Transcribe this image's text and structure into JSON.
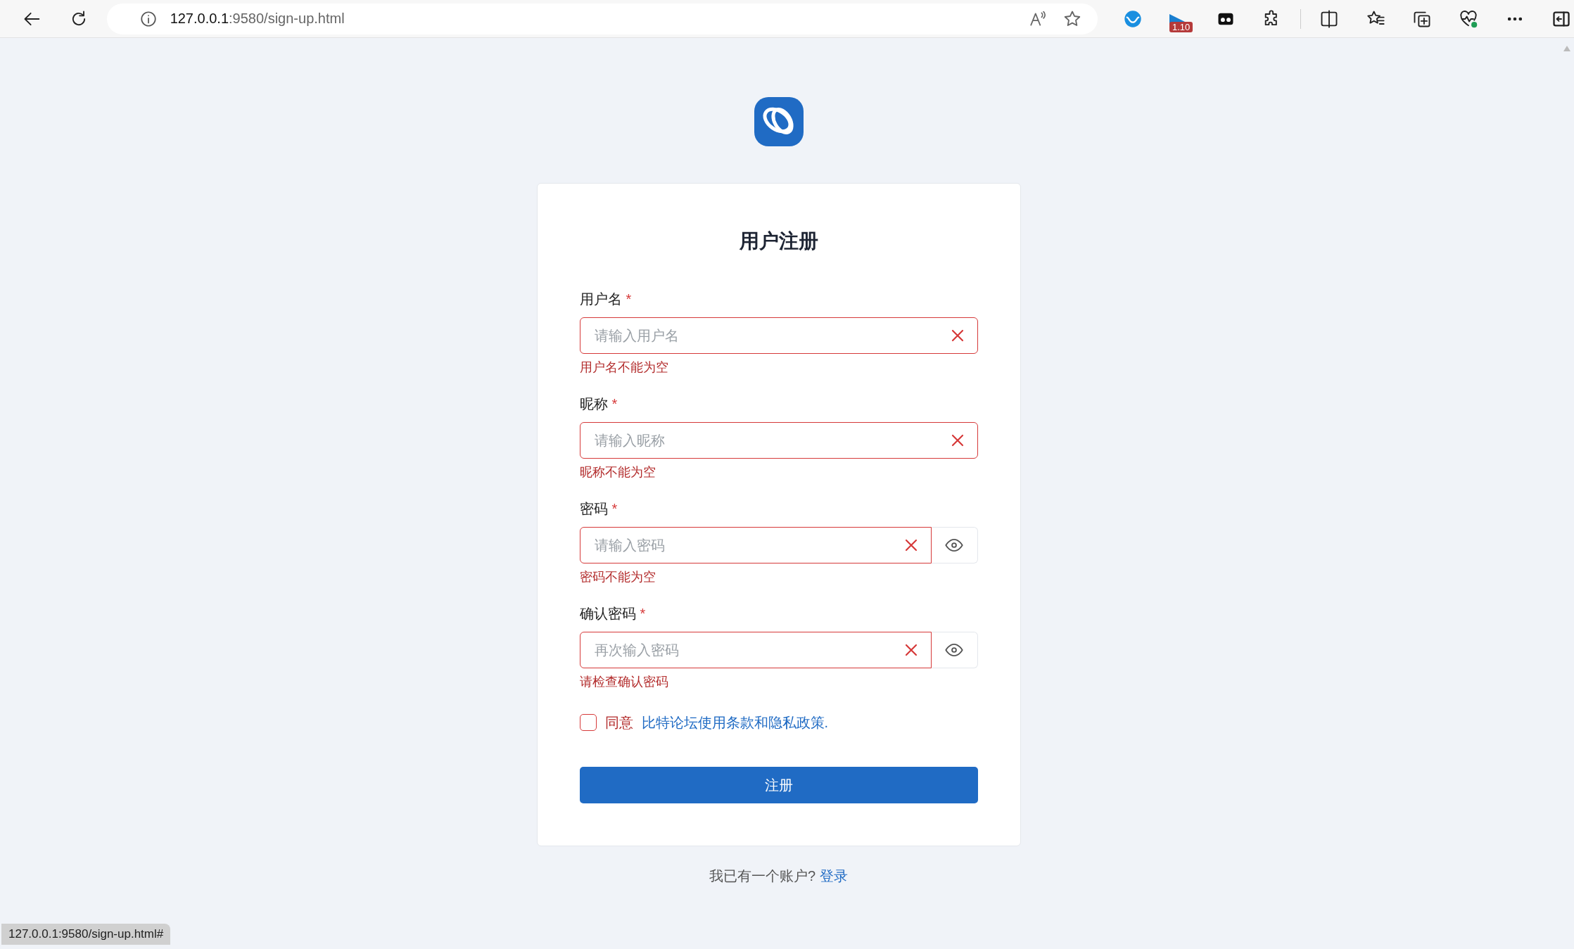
{
  "browser": {
    "url_host": "127.0.0.1",
    "url_rest": ":9580/sign-up.html",
    "extension_badge": "1.10"
  },
  "title": "用户注册",
  "fields": [
    {
      "label": "用户名",
      "required_mark": "*",
      "placeholder": "请输入用户名",
      "invalid": true,
      "error": "用户名不能为空",
      "password": false
    },
    {
      "label": "昵称",
      "required_mark": "*",
      "placeholder": "请输入昵称",
      "invalid": true,
      "error": "昵称不能为空",
      "password": false
    },
    {
      "label": "密码",
      "required_mark": "*",
      "placeholder": "请输入密码",
      "invalid": true,
      "error": "密码不能为空",
      "password": true
    },
    {
      "label": "确认密码",
      "required_mark": "*",
      "placeholder": "再次输入密码",
      "invalid": true,
      "error": "请检查确认密码",
      "password": true
    }
  ],
  "agreement": {
    "checked": false,
    "prefix": "同意",
    "link": "比特论坛使用条款和隐私政策."
  },
  "submit": "注册",
  "footer": {
    "text": "我已有一个账户?",
    "link": "登录"
  },
  "status_bar": "127.0.0.1:9580/sign-up.html#"
}
